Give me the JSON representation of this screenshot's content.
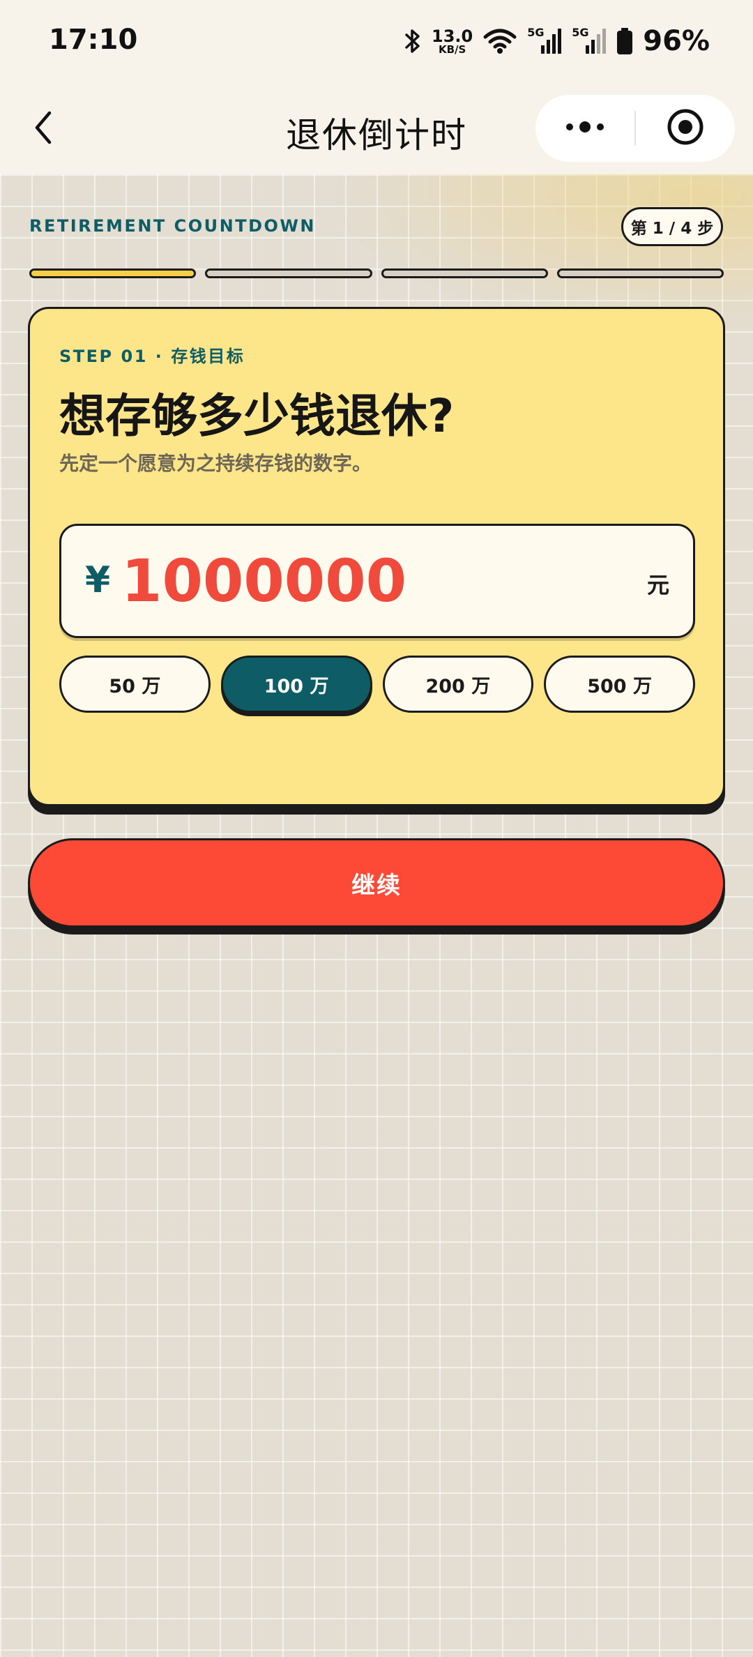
{
  "status_bar": {
    "time": "17:10",
    "speed_value": "13.0",
    "speed_unit": "KB/S",
    "network_1": "5G",
    "network_2": "5G",
    "battery": "96%"
  },
  "nav": {
    "title": "退休倒计时"
  },
  "header": {
    "eyebrow": "RETIREMENT COUNTDOWN",
    "step_badge": "第 1 / 4 步",
    "progress": {
      "current_step": 1,
      "total_steps": 4
    }
  },
  "card": {
    "step_label": "STEP 01 · 存钱目标",
    "question": "想存够多少钱退休?",
    "helper": "先定一个愿意为之持续存钱的数字。",
    "currency_symbol": "¥",
    "amount": "1000000",
    "unit": "元",
    "presets": [
      {
        "label": "50 万",
        "selected": false
      },
      {
        "label": "100 万",
        "selected": true
      },
      {
        "label": "200 万",
        "selected": false
      },
      {
        "label": "500 万",
        "selected": false
      }
    ]
  },
  "actions": {
    "continue_label": "继续"
  },
  "colors": {
    "accent_teal": "#0e5c66",
    "accent_red": "#fc4a36",
    "card_yellow": "#fde68a",
    "progress_active": "#f4cf47"
  },
  "icons": {
    "back": "chevron-left-icon",
    "more": "more-dots-icon",
    "target": "target-icon",
    "bluetooth": "bluetooth-icon",
    "wifi": "wifi-icon",
    "signal": "signal-icon",
    "battery": "battery-icon"
  }
}
